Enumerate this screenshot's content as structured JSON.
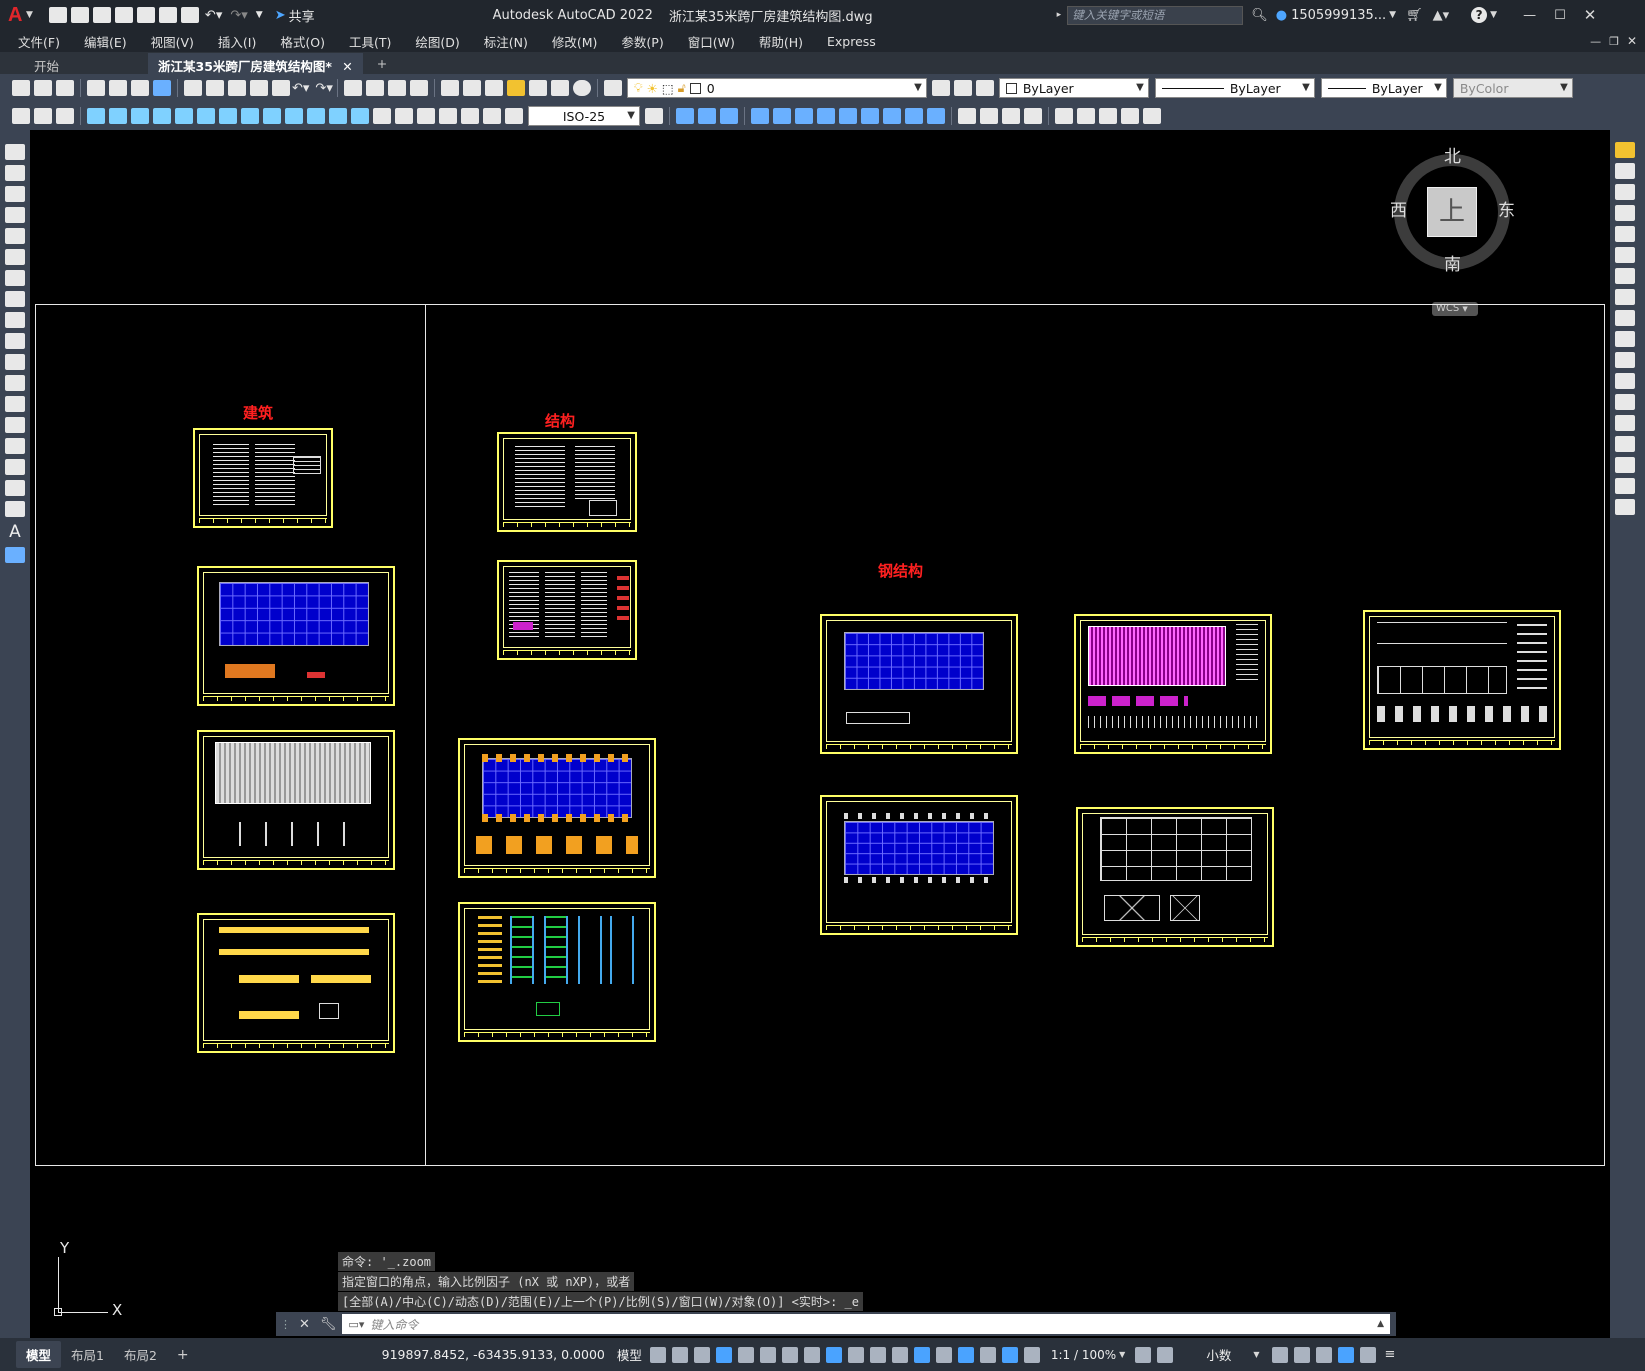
{
  "app": {
    "logo_letter": "A",
    "title": "Autodesk AutoCAD 2022",
    "document": "浙江某35米跨厂房建筑结构图.dwg",
    "share_label": "共享",
    "search_placeholder": "键入关键字或短语",
    "username": "1505999135...",
    "help": "?"
  },
  "menu": {
    "items": [
      "文件(F)",
      "编辑(E)",
      "视图(V)",
      "插入(I)",
      "格式(O)",
      "工具(T)",
      "绘图(D)",
      "标注(N)",
      "修改(M)",
      "参数(P)",
      "窗口(W)",
      "帮助(H)",
      "Express"
    ]
  },
  "tabs": {
    "start": "开始",
    "active": "浙江某35米跨厂房建筑结构图*",
    "add": "+"
  },
  "toolbar": {
    "layer_value": "0",
    "color_value": "ByLayer",
    "linetype_value": "ByLayer",
    "lineweight_value": "ByLayer",
    "plotstyle_value": "ByColor",
    "dimstyle_value": "ISO-25"
  },
  "viewcube": {
    "north": "北",
    "south": "南",
    "east": "东",
    "west": "西",
    "top": "上",
    "wcs": "WCS"
  },
  "drawing": {
    "label_arch": "建筑",
    "label_struct": "结构",
    "label_steel": "钢结构"
  },
  "ucs": {
    "x": "X",
    "y": "Y"
  },
  "command": {
    "history": [
      "命令: '_.zoom",
      "指定窗口的角点，输入比例因子 (nX 或 nXP)，或者",
      "[全部(A)/中心(C)/动态(D)/范围(E)/上一个(P)/比例(S)/窗口(W)/对象(O)] <实时>: _e"
    ],
    "placeholder": "键入命令"
  },
  "status": {
    "layout_tabs": [
      "模型",
      "布局1",
      "布局2"
    ],
    "add": "+",
    "coords": "919897.8452, -63435.9133, 0.0000",
    "model": "模型",
    "scale": "1:1 / 100%",
    "units": "小数"
  },
  "colors": {
    "sheet_border": "#ffff66",
    "label_red": "#ff2020",
    "grid_blue": "#0000cc",
    "grid_magenta": "#cc22cc",
    "status_on": "#4aa3ff"
  }
}
